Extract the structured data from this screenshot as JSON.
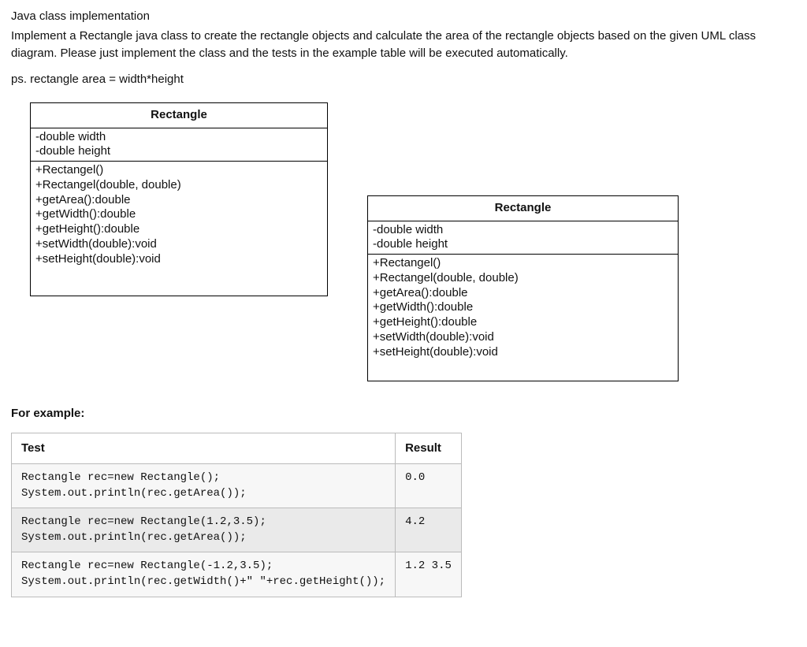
{
  "header": {
    "title": "Java class implementation",
    "description": "Implement a Rectangle java class to create the rectangle objects and calculate the area of the rectangle objects based on the given UML class diagram. Please just implement the class and the tests in the example table will be executed automatically.",
    "ps": "ps. rectangle area = width*height"
  },
  "uml_left": {
    "class_name": "Rectangle",
    "attr1": "-double width",
    "attr2": "-double height",
    "m1": "+Rectangel()",
    "m2": "+Rectangel(double, double)",
    "m3": "+getArea():double",
    "m4": "+getWidth():double",
    "m5": "+getHeight():double",
    "m6": "+setWidth(double):void",
    "m7": "+setHeight(double):void"
  },
  "uml_right": {
    "class_name": "Rectangle",
    "attr1": "-double width",
    "attr2": "-double height",
    "m1": "+Rectangel()",
    "m2": "+Rectangel(double, double)",
    "m3": "+getArea():double",
    "m4": "+getWidth():double",
    "m5": "+getHeight():double",
    "m6": "+setWidth(double):void",
    "m7": "+setHeight(double):void"
  },
  "example": {
    "heading": "For example:",
    "col_test": "Test",
    "col_result": "Result",
    "rows": [
      {
        "test": "Rectangle rec=new Rectangle();\nSystem.out.println(rec.getArea());",
        "result": "0.0"
      },
      {
        "test": "Rectangle rec=new Rectangle(1.2,3.5);\nSystem.out.println(rec.getArea());",
        "result": "4.2"
      },
      {
        "test": "Rectangle rec=new Rectangle(-1.2,3.5);\nSystem.out.println(rec.getWidth()+\" \"+rec.getHeight());",
        "result": "1.2 3.5"
      }
    ]
  }
}
